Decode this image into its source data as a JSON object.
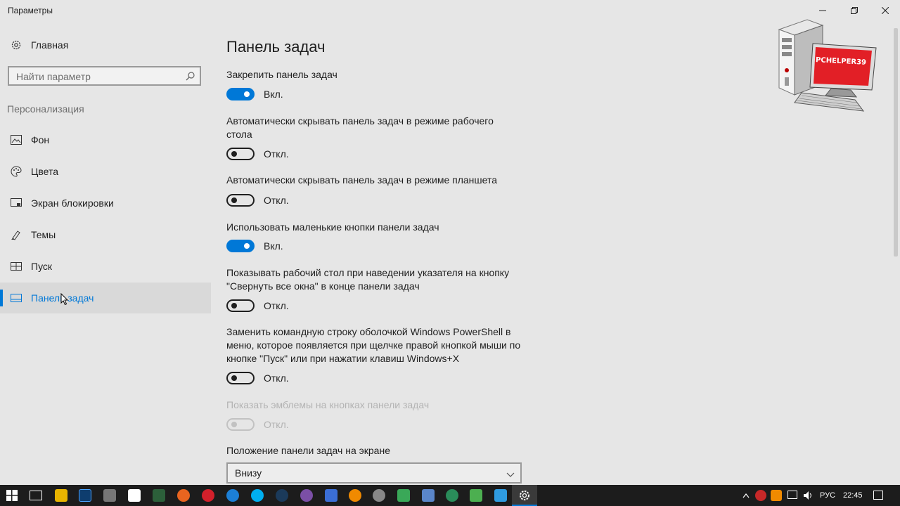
{
  "window": {
    "title": "Параметры",
    "minimize_icon": "minimize-icon",
    "maximize_icon": "restore-icon",
    "close_icon": "close-icon"
  },
  "sidebar": {
    "home_label": "Главная",
    "search_placeholder": "Найти параметр",
    "section_title": "Персонализация",
    "items": [
      {
        "label": "Фон",
        "icon": "image-icon"
      },
      {
        "label": "Цвета",
        "icon": "palette-icon"
      },
      {
        "label": "Экран блокировки",
        "icon": "lock-screen-icon"
      },
      {
        "label": "Темы",
        "icon": "themes-icon"
      },
      {
        "label": "Пуск",
        "icon": "start-icon"
      },
      {
        "label": "Панель задач",
        "icon": "taskbar-icon",
        "active": true
      }
    ]
  },
  "main": {
    "title": "Панель задач",
    "settings": [
      {
        "label": "Закрепить панель задач",
        "state": "Вкл.",
        "on": true
      },
      {
        "label": "Автоматически скрывать панель задач в режиме рабочего стола",
        "state": "Откл.",
        "on": false
      },
      {
        "label": "Автоматически скрывать панель задач в режиме планшета",
        "state": "Откл.",
        "on": false
      },
      {
        "label": "Использовать маленькие кнопки панели задач",
        "state": "Вкл.",
        "on": true
      },
      {
        "label": "Показывать рабочий стол при наведении указателя на кнопку \"Свернуть все окна\" в конце панели задач",
        "state": "Откл.",
        "on": false
      },
      {
        "label": "Заменить командную строку оболочкой Windows PowerShell в меню, которое появляется при щелчке правой кнопкой мыши по кнопке \"Пуск\" или при нажатии клавиш Windows+X",
        "state": "Откл.",
        "on": false
      },
      {
        "label": "Показать эмблемы на кнопках панели задач",
        "state": "Откл.",
        "on": false,
        "disabled": true
      }
    ],
    "position_label": "Положение панели задач на экране",
    "position_value": "Внизу"
  },
  "logo": {
    "text": "PCHELPER39"
  },
  "taskbar": {
    "language": "РУС",
    "time": "22:45",
    "colors": {
      "accent": "#0078d7",
      "background": "#1c1c1c"
    }
  }
}
